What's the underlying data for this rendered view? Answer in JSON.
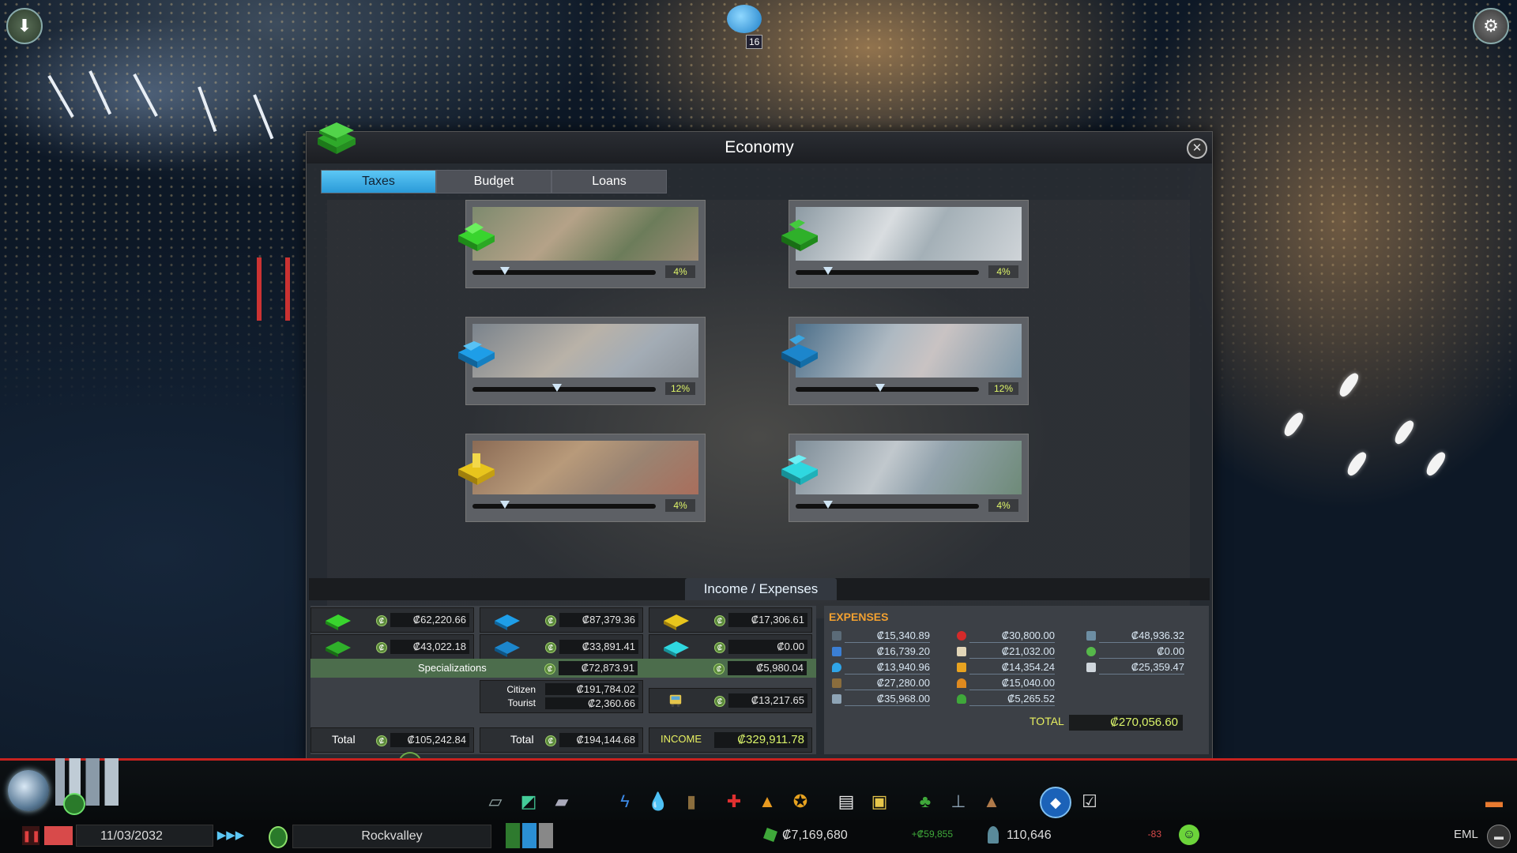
{
  "window": {
    "title": "Economy"
  },
  "tabs": [
    {
      "label": "Taxes",
      "active": true
    },
    {
      "label": "Budget",
      "active": false
    },
    {
      "label": "Loans",
      "active": false
    }
  ],
  "taxes": [
    {
      "zone": "Residential low density",
      "icon": "residential-low-icon",
      "color": "#39d42e",
      "value": "4%",
      "rate": 4
    },
    {
      "zone": "Residential high density",
      "icon": "residential-high-icon",
      "color": "#2fb02a",
      "value": "4%",
      "rate": 4
    },
    {
      "zone": "Commercial low density",
      "icon": "commercial-low-icon",
      "color": "#1e9ee8",
      "value": "12%",
      "rate": 12
    },
    {
      "zone": "Commercial high density",
      "icon": "commercial-high-icon",
      "color": "#1c86cc",
      "value": "12%",
      "rate": 12
    },
    {
      "zone": "Industrial",
      "icon": "industrial-icon",
      "color": "#e8c51c",
      "value": "4%",
      "rate": 4
    },
    {
      "zone": "Office",
      "icon": "office-icon",
      "color": "#2fd8e0",
      "value": "4%",
      "rate": 4
    }
  ],
  "income_expenses": {
    "title": "Income / Expenses",
    "residential": {
      "low": "₡62,220.66",
      "high": "₡43,022.18",
      "total_label": "Total",
      "total": "₡105,242.84"
    },
    "commercial": {
      "low": "₡87,379.36",
      "high": "₡33,891.41"
    },
    "industrial_office": {
      "industrial": "₡17,306.61",
      "office": "₡0.00"
    },
    "specializations": {
      "label": "Specializations",
      "commercial": "₡72,873.91",
      "industrial": "₡5,980.04"
    },
    "citizen_tourist": {
      "citizen_label": "Citizen",
      "citizen": "₡191,784.02",
      "tourist_label": "Tourist",
      "tourist": "₡2,360.66",
      "total_label": "Total",
      "total": "₡194,144.68"
    },
    "public_transport": "₡13,217.65",
    "income_label": "INCOME",
    "income_total": "₡329,911.78"
  },
  "expenses": {
    "title": "EXPENSES",
    "columns": [
      [
        {
          "icon": "road-icon",
          "value": "₡15,340.89"
        },
        {
          "icon": "electricity-icon",
          "value": "₡16,739.20"
        },
        {
          "icon": "water-icon",
          "value": "₡13,940.96"
        },
        {
          "icon": "garbage-icon",
          "value": "₡27,280.00"
        },
        {
          "icon": "monument-icon",
          "value": "₡35,968.00"
        }
      ],
      [
        {
          "icon": "healthcare-icon",
          "value": "₡30,800.00"
        },
        {
          "icon": "education-icon",
          "value": "₡21,032.00"
        },
        {
          "icon": "police-icon",
          "value": "₡14,354.24"
        },
        {
          "icon": "fire-icon",
          "value": "₡15,040.00"
        },
        {
          "icon": "parks-icon",
          "value": "₡5,265.52"
        }
      ],
      [
        {
          "icon": "transport-icon",
          "value": "₡48,936.32"
        },
        {
          "icon": "policies-icon",
          "value": "₡0.00"
        },
        {
          "icon": "loans-icon",
          "value": "₡25,359.47"
        }
      ]
    ],
    "total_label": "TOTAL",
    "total": "₡270,056.60"
  },
  "status_bar": {
    "date": "11/03/2032",
    "city_name": "Rockvalley",
    "money": "₡7,169,680",
    "money_change": "+₡59,855",
    "population": "110,646",
    "population_change": "-83",
    "eml_label": "EML"
  },
  "overlay": {
    "bird_count": "16"
  },
  "toolbar_icons": [
    "roads-icon",
    "zoning-icon",
    "districts-icon",
    "electricity-icon",
    "water-icon",
    "garbage-icon",
    "healthcare-icon",
    "fire-icon",
    "police-icon",
    "education-icon",
    "transport-icon",
    "parks-icon",
    "unique-buildings-icon",
    "monuments-icon",
    "wonders-icon",
    "checklist-icon"
  ]
}
